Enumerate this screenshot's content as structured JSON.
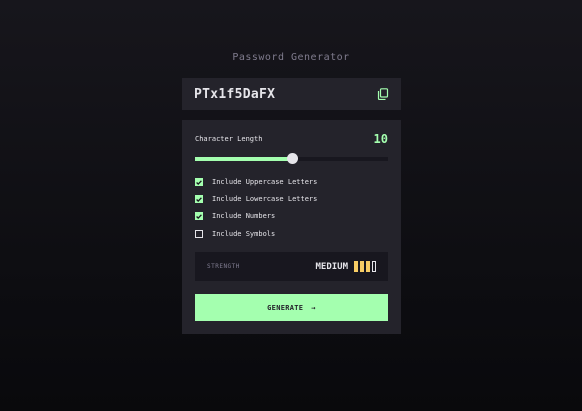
{
  "app": {
    "title": "Password Generator"
  },
  "password": {
    "value": "PTx1f5DaFX",
    "copy_icon": "copy-icon"
  },
  "length": {
    "label": "Character Length",
    "value": "10",
    "slider_fraction": 0.5
  },
  "options": [
    {
      "label": "Include Uppercase Letters",
      "checked": true
    },
    {
      "label": "Include Lowercase Letters",
      "checked": true
    },
    {
      "label": "Include Numbers",
      "checked": true
    },
    {
      "label": "Include Symbols",
      "checked": false
    }
  ],
  "strength": {
    "label": "STRENGTH",
    "value": "MEDIUM",
    "level": 3,
    "max": 4
  },
  "generate": {
    "label": "GENERATE",
    "arrow": "→"
  },
  "colors": {
    "accent": "#a4ffaf",
    "strength_bar": "#f8cd65",
    "panel": "#24232b",
    "text": "#e6e5ea"
  }
}
